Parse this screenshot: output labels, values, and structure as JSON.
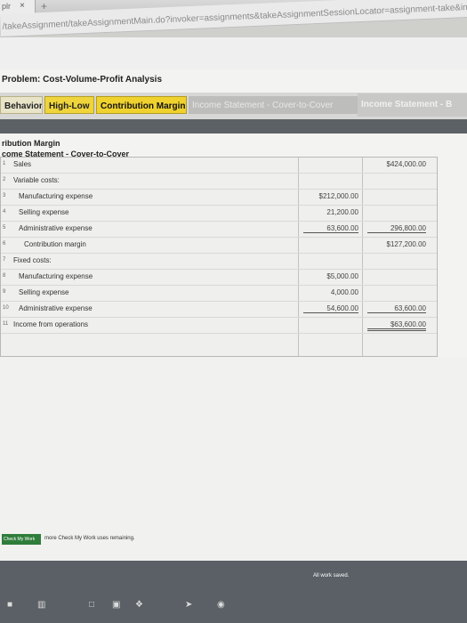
{
  "browser": {
    "tab_text": "plr",
    "tab_close": "×",
    "new_tab": "+",
    "url": "/takeAssignment/takeAssignmentMain.do?invoker=assignments&takeAssignmentSessionLocator=assignment-take&inprog"
  },
  "problem": {
    "title": "Problem: Cost-Volume-Profit Analysis"
  },
  "tabs": [
    {
      "label": "Behavior"
    },
    {
      "label": "High-Low"
    },
    {
      "label": "Contribution Margin"
    },
    {
      "label": "Income Statement - Cover-to-Cover"
    },
    {
      "label": "Income Statement - B"
    }
  ],
  "section": {
    "title": "ribution Margin",
    "statement_title": "come Statement - Cover-to-Cover"
  },
  "statement": {
    "rows": [
      {
        "num": "1",
        "label": "Sales",
        "v1": "",
        "v2": "$424,000.00"
      },
      {
        "num": "2",
        "label": "Variable costs:",
        "v1": "",
        "v2": ""
      },
      {
        "num": "3",
        "label": "Manufacturing expense",
        "v1": "$212,000.00",
        "v2": ""
      },
      {
        "num": "4",
        "label": "Selling expense",
        "v1": "21,200.00",
        "v2": ""
      },
      {
        "num": "5",
        "label": "Administrative expense",
        "v1": "63,600.00",
        "v2": "296,800.00"
      },
      {
        "num": "6",
        "label": "Contribution margin",
        "v1": "",
        "v2": "$127,200.00"
      },
      {
        "num": "7",
        "label": "Fixed costs:",
        "v1": "",
        "v2": ""
      },
      {
        "num": "8",
        "label": "Manufacturing expense",
        "v1": "$5,000.00",
        "v2": ""
      },
      {
        "num": "9",
        "label": "Selling expense",
        "v1": "4,000.00",
        "v2": ""
      },
      {
        "num": "10",
        "label": "Administrative expense",
        "v1": "54,600.00",
        "v2": "63,600.00"
      },
      {
        "num": "11",
        "label": "Income from operations",
        "v1": "",
        "v2": "$63,600.00"
      }
    ]
  },
  "footer": {
    "check_button": "Check My Work",
    "check_note": "more Check My Work uses remaining.",
    "saved": "All work saved."
  },
  "taskbar_icons": [
    "windows-icon",
    "apps-icon",
    "folder-icon",
    "store-icon",
    "dropbox-icon",
    "arrow-icon",
    "browser-icon"
  ]
}
